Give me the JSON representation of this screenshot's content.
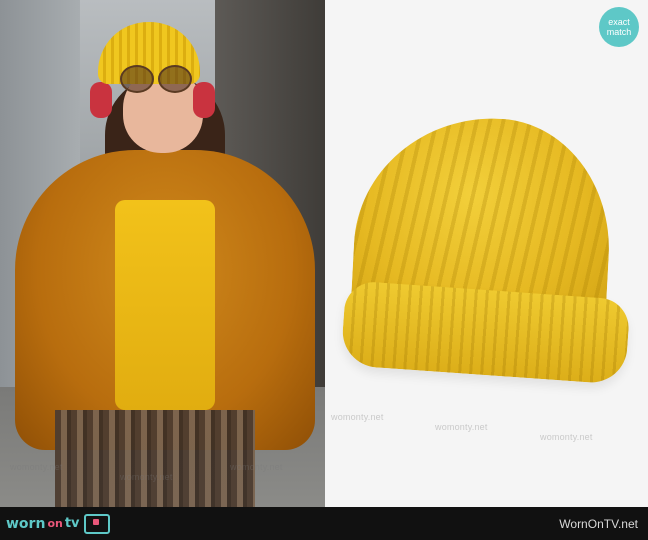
{
  "badge": {
    "line1": "exact",
    "line2": "match"
  },
  "watermark_text": "womonty.net",
  "footer": {
    "logo_worn": "worn",
    "logo_on": "on",
    "logo_tv": "tv",
    "site": "WornOnTV.net"
  },
  "colors": {
    "accent": "#5ec8c7",
    "pink": "#e9577a",
    "bar": "#111111",
    "beanie": "#e6b922"
  }
}
